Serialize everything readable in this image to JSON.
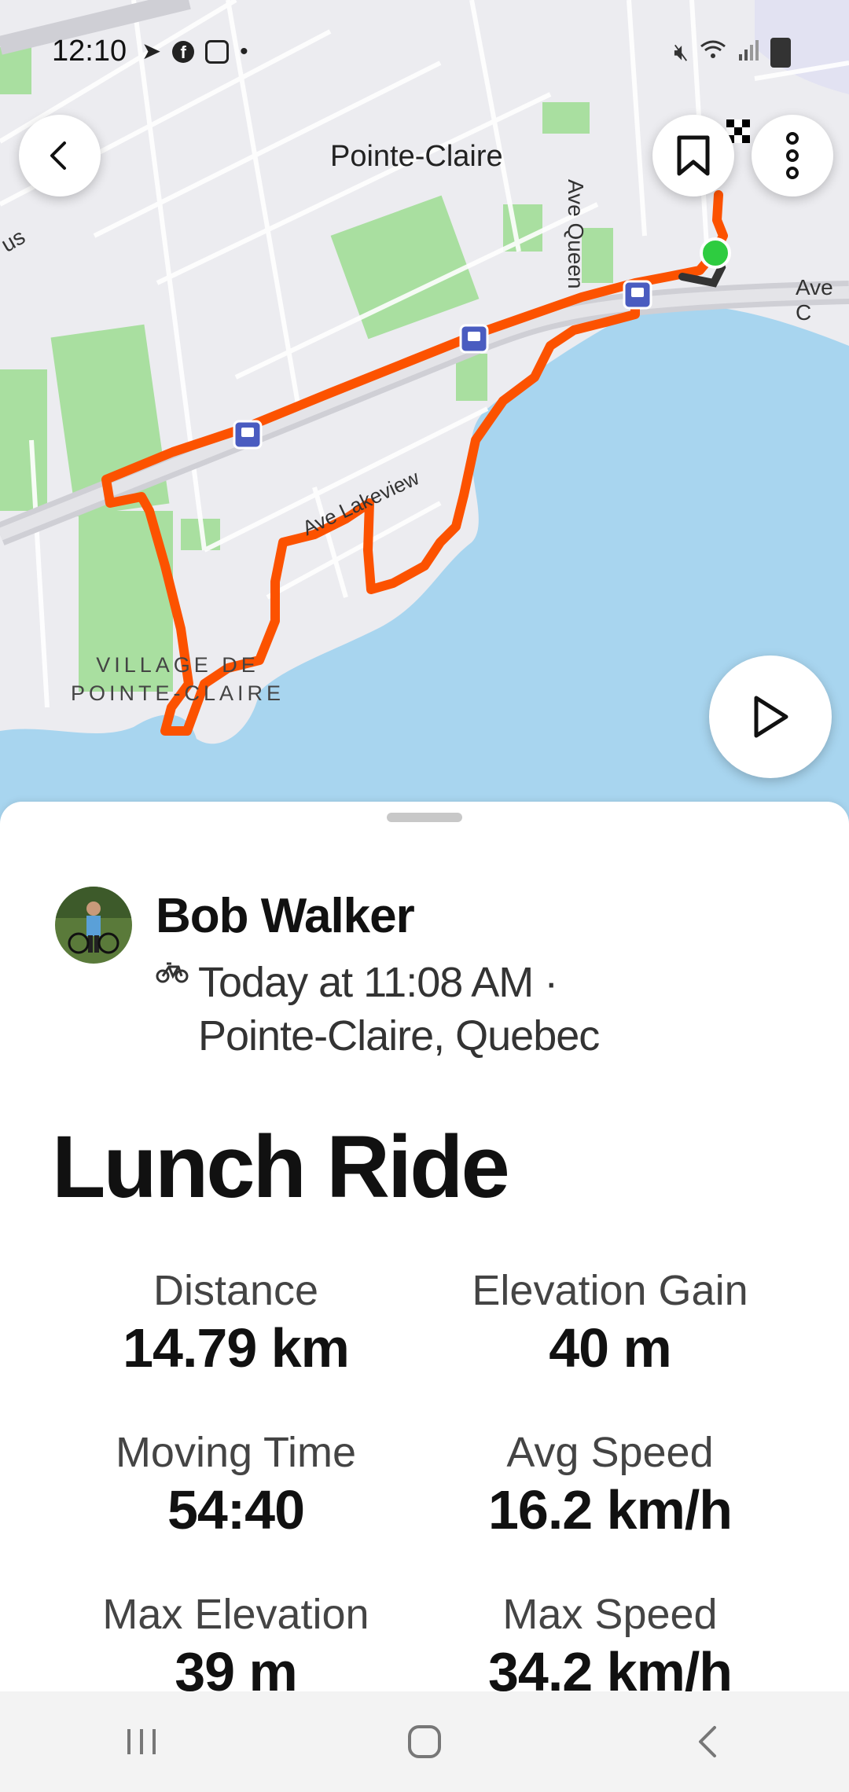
{
  "status_bar": {
    "time": "12:10",
    "left_icons": [
      "navigation-arrow-icon",
      "facebook-icon",
      "instagram-icon",
      "dot-icon"
    ],
    "right_icons": [
      "mute-icon",
      "wifi-icon",
      "signal-icon",
      "battery-icon"
    ]
  },
  "map": {
    "labels": {
      "pointe_claire": "Pointe-Claire",
      "village_line1": "VILLAGE DE",
      "village_line2": "POINTE-CLAIRE",
      "ave_queen": "Ave Queen",
      "ave_lakeview": "Ave Lakeview",
      "ave_c": "Ave C",
      "us": "us"
    },
    "colors": {
      "land": "#ececf0",
      "water": "#a8d5ef",
      "park": "#a9dfa0",
      "route": "#fc5200",
      "highway": "#d4d4d8",
      "start_marker": "#2ecc40"
    }
  },
  "header_buttons": {
    "back": "back-arrow-icon",
    "bookmark": "bookmark-icon",
    "more": "more-vertical-icon",
    "play": "play-icon"
  },
  "activity": {
    "athlete_name": "Bob Walker",
    "sport_icon": "bike-icon",
    "datetime": "Today at 11:08 AM ·",
    "location": "Pointe-Claire, Quebec",
    "title": "Lunch Ride",
    "stats": [
      {
        "label": "Distance",
        "value": "14.79 km"
      },
      {
        "label": "Elevation Gain",
        "value": "40 m"
      },
      {
        "label": "Moving Time",
        "value": "54:40"
      },
      {
        "label": "Avg Speed",
        "value": "16.2 km/h"
      },
      {
        "label": "Max Elevation",
        "value": "39 m"
      },
      {
        "label": "Max Speed",
        "value": "34.2 km/h"
      }
    ]
  },
  "nav_bar": {
    "recents": "recents-icon",
    "home": "home-icon",
    "back": "nav-back-icon"
  }
}
